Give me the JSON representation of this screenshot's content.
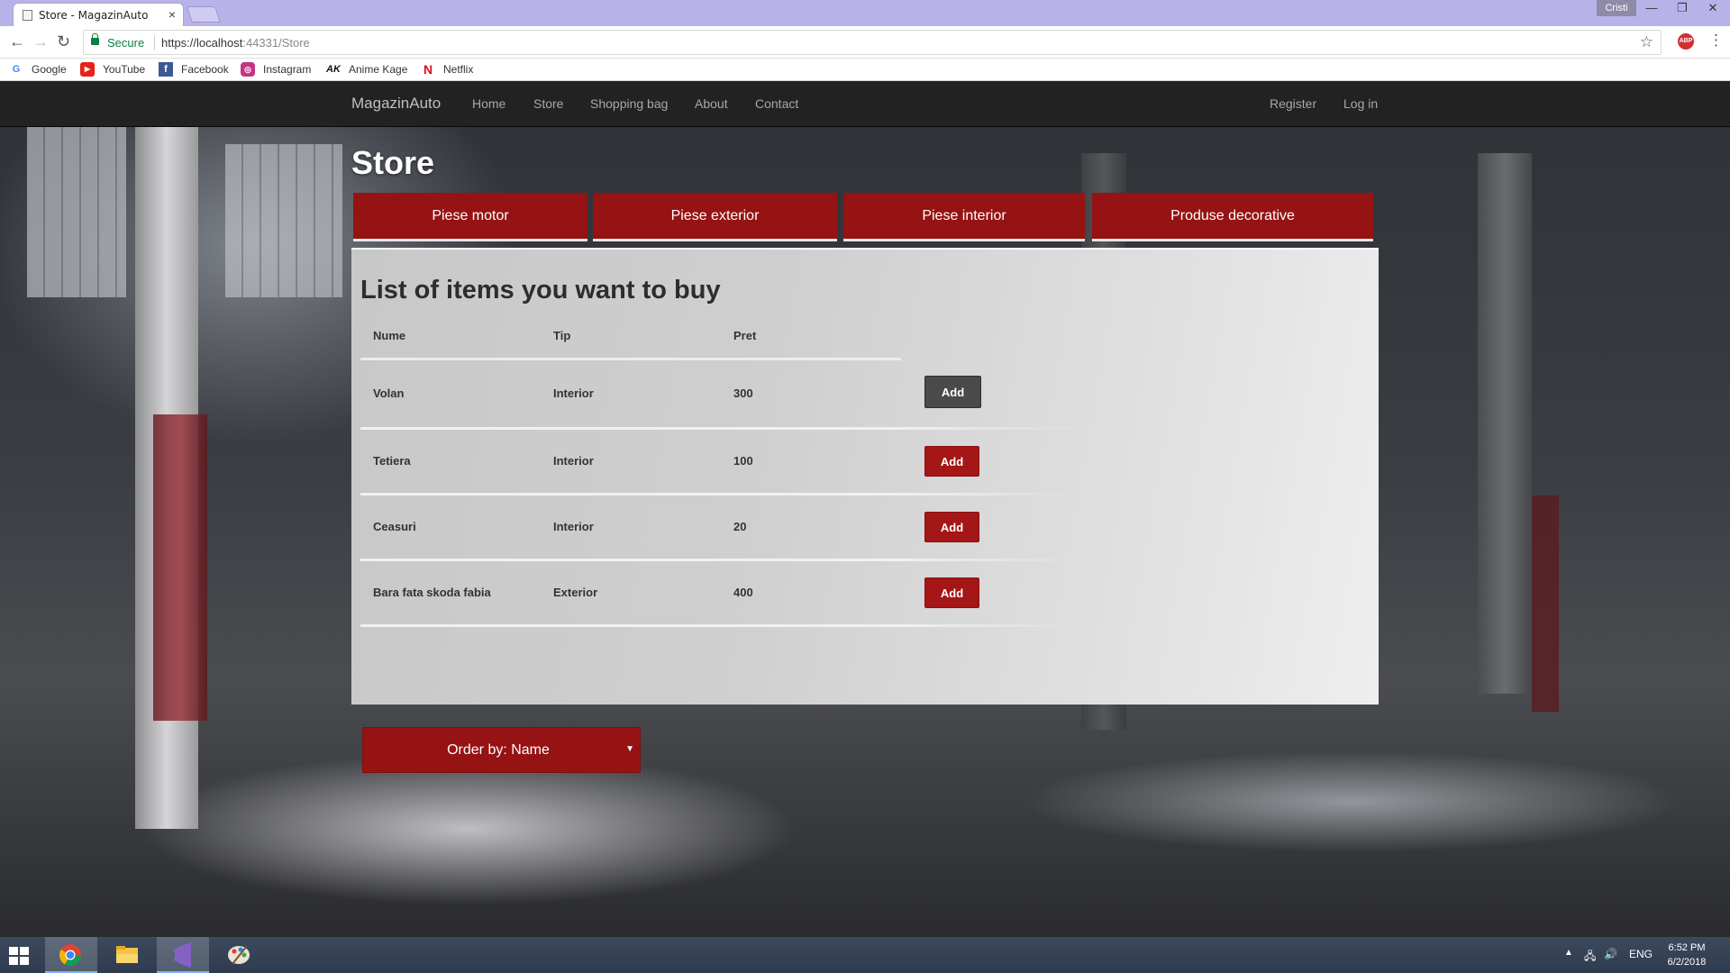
{
  "browser": {
    "tab_title": "Store - MagazinAuto",
    "tab_close": "×",
    "profile_name": "Cristi",
    "window_buttons": [
      "—",
      "❐",
      "✕"
    ],
    "secure_label": "Secure",
    "url_host": "https://localhost",
    "url_path": ":44331/Store",
    "abp_label": "ABP",
    "bookmarks": [
      {
        "label": "Google",
        "icon": "google-icon"
      },
      {
        "label": "YouTube",
        "icon": "youtube-icon"
      },
      {
        "label": "Facebook",
        "icon": "facebook-icon"
      },
      {
        "label": "Instagram",
        "icon": "instagram-icon"
      },
      {
        "label": "Anime Kage",
        "icon": "animekage-icon"
      },
      {
        "label": "Netflix",
        "icon": "netflix-icon"
      }
    ]
  },
  "navbar": {
    "brand": "MagazinAuto",
    "links": [
      "Home",
      "Store",
      "Shopping bag",
      "About",
      "Contact"
    ],
    "right_links": [
      "Register",
      "Log in"
    ]
  },
  "page": {
    "title": "Store",
    "categories": [
      "Piese motor",
      "Piese exterior",
      "Piese interior",
      "Produse decorative"
    ],
    "list_heading": "List of items you want to buy",
    "columns": [
      "Nume",
      "Tip",
      "Pret"
    ],
    "items": [
      {
        "name": "Volan",
        "type": "Interior",
        "price": "300",
        "button": "Add"
      },
      {
        "name": "Tetiera",
        "type": "Interior",
        "price": "100",
        "button": "Add"
      },
      {
        "name": "Ceasuri",
        "type": "Interior",
        "price": "20",
        "button": "Add"
      },
      {
        "name": "Bara fata skoda fabia",
        "type": "Exterior",
        "price": "400",
        "button": "Add"
      }
    ],
    "order_by": "Order by: Name"
  },
  "taskbar": {
    "apps": [
      "chrome-icon",
      "file-explorer-icon",
      "visual-studio-icon",
      "paint-icon"
    ],
    "language": "ENG",
    "time": "6:52 PM",
    "date": "6/2/2018"
  },
  "colors": {
    "accent_red": "#961313",
    "button_red": "#a51616",
    "navbar_bg": "#222222"
  }
}
